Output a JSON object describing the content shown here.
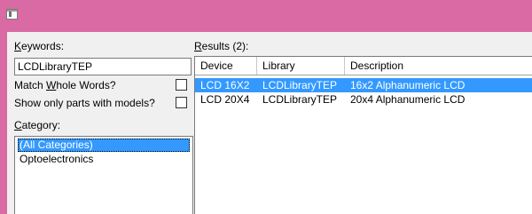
{
  "window": {
    "title": ""
  },
  "search": {
    "keywords_label": "Keywords:",
    "keywords_value": "LCDLibraryTEP",
    "match_whole_words_label": "Match Whole Words?",
    "match_whole_words_checked": false,
    "models_only_label": "Show only parts with models?",
    "models_only_checked": false
  },
  "category": {
    "label": "Category:",
    "items": [
      {
        "label": "(All Categories)",
        "selected": true
      },
      {
        "label": "Optoelectronics",
        "selected": false
      }
    ]
  },
  "results": {
    "label": "Results (2):",
    "columns": [
      "Device",
      "Library",
      "Description"
    ],
    "rows": [
      {
        "device": "LCD 16X2",
        "library": "LCDLibraryTEP",
        "description": "16x2 Alphanumeric LCD",
        "selected": true
      },
      {
        "device": "LCD 20X4",
        "library": "LCDLibraryTEP",
        "description": "20x4 Alphanumeric LCD",
        "selected": false
      }
    ]
  },
  "colors": {
    "window_frame": "#d96aa3",
    "dialog_bg": "#f0f0f0",
    "selection": "#3399ff"
  }
}
